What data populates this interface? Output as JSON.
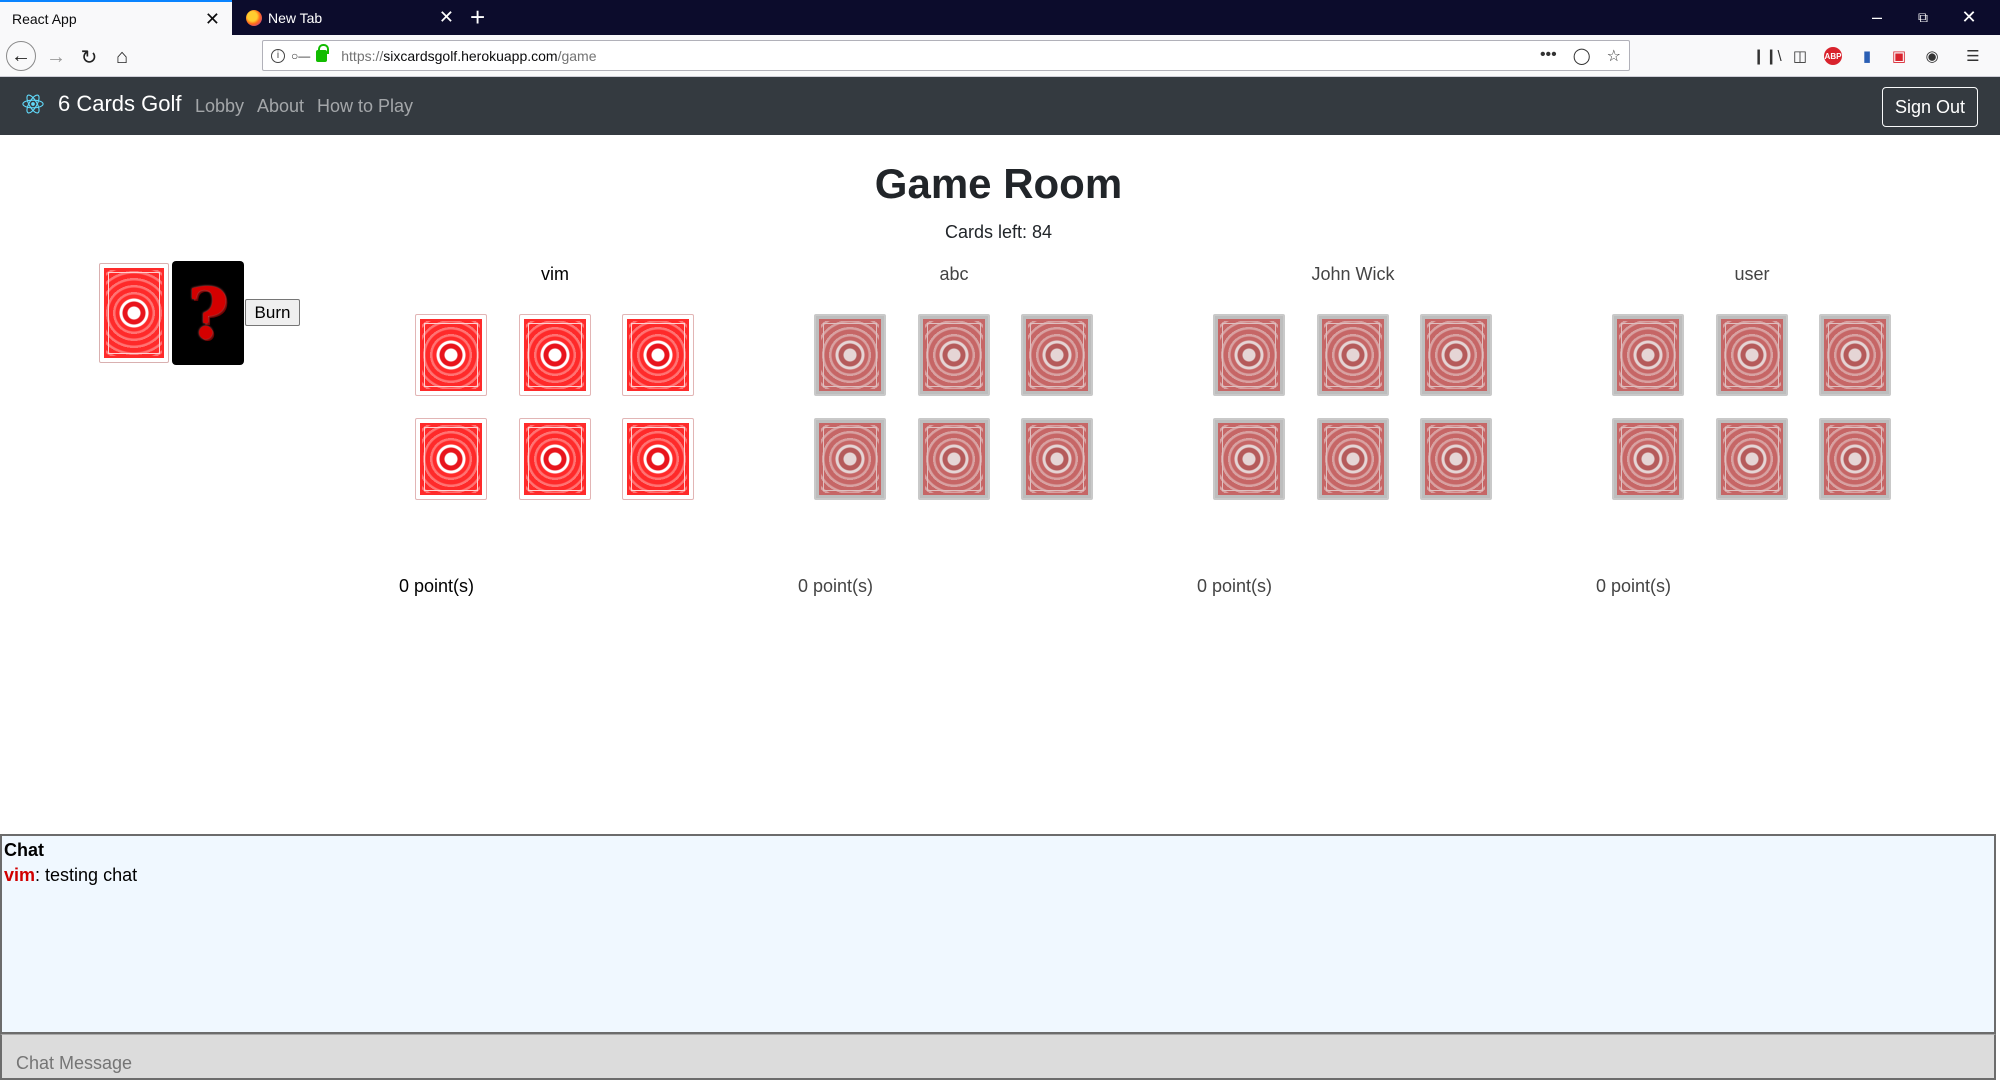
{
  "browser": {
    "tabs": [
      {
        "title": "React App",
        "active": true
      },
      {
        "title": "New Tab",
        "active": false
      }
    ],
    "url_prefix": "https://",
    "url_host": "sixcardsgolf.herokuapp.com",
    "url_path": "/game",
    "icons": [
      "back-icon",
      "forward-icon",
      "reload-icon",
      "home-icon",
      "info-icon",
      "key-icon",
      "lock-icon",
      "more-icon",
      "pocket-icon",
      "bookmark-star-icon",
      "library-icon",
      "sidebar-icon",
      "adblock-icon",
      "extension-icon",
      "pocket-save-icon",
      "account-icon",
      "menu-icon"
    ]
  },
  "appnav": {
    "brand": "6 Cards Golf",
    "links": [
      "Lobby",
      "About",
      "How to Play"
    ],
    "sign_out": "Sign Out"
  },
  "game": {
    "title": "Game Room",
    "cards_left": "Cards left: 84",
    "burn_label": "Burn",
    "mystery_glyph": "?",
    "players": [
      {
        "name": "vim",
        "points": "0 point(s)",
        "active": true
      },
      {
        "name": "abc",
        "points": "0 point(s)",
        "active": false
      },
      {
        "name": "John Wick",
        "points": "0 point(s)",
        "active": false
      },
      {
        "name": "user",
        "points": "0 point(s)",
        "active": false
      }
    ]
  },
  "chat": {
    "title": "Chat",
    "messages": [
      {
        "user": "vim",
        "text": ": testing chat"
      }
    ],
    "input_placeholder": "Chat Message"
  },
  "colors": {
    "navbar": "#343a40",
    "chrome_dark": "#0c0c2c",
    "chat_bg": "#f0f8ff",
    "chat_user": "#d10000",
    "card_red": "#ff2a2a"
  }
}
